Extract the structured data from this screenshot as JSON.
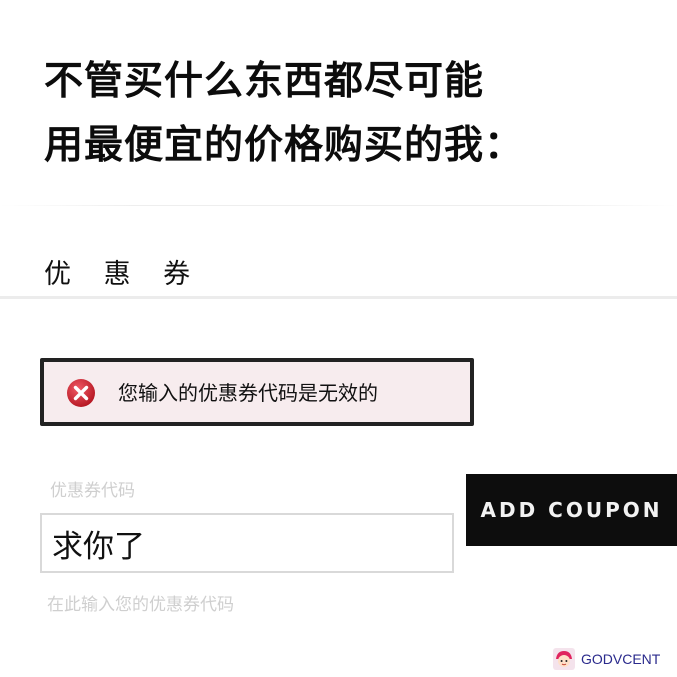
{
  "caption": {
    "line1": "不管买什么东西都尽可能",
    "line2": "用最便宜的价格购买的我："
  },
  "coupon_section": {
    "title": "优 惠 券"
  },
  "error": {
    "icon": "error-x-icon",
    "message": "您输入的优惠券代码是无效的",
    "icon_color": "#d21f2f",
    "background": "#f7ecee"
  },
  "coupon_form": {
    "field_label": "优惠券代码",
    "input_value": "求你了",
    "hint": "在此输入您的优惠券代码",
    "button_label": "ADD COUPON"
  },
  "watermark": {
    "text": "GODVCENT",
    "logo": "cartoon-face-logo"
  }
}
